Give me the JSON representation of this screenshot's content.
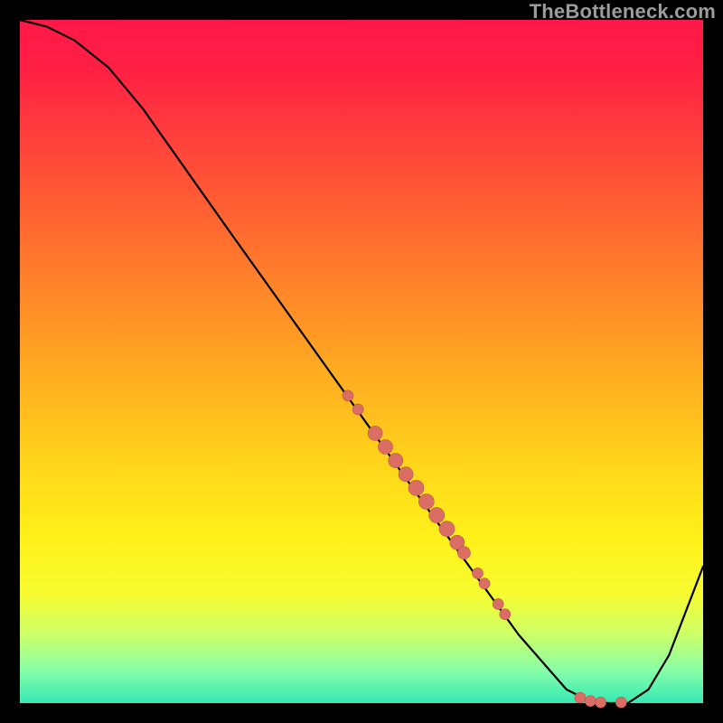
{
  "watermark": "TheBottleneck.com",
  "colors": {
    "marker_fill": "#db6e64",
    "marker_stroke": "#b95148",
    "curve_stroke": "#000000"
  },
  "chart_data": {
    "type": "line",
    "title": "",
    "xlabel": "",
    "ylabel": "",
    "xlim": [
      0,
      100
    ],
    "ylim": [
      0,
      100
    ],
    "grid": false,
    "curve": {
      "x": [
        0,
        4,
        8,
        13,
        18,
        30,
        45,
        60,
        73,
        80,
        83,
        86,
        89,
        92,
        95,
        100
      ],
      "values": [
        100,
        99,
        97,
        93,
        87,
        70,
        49,
        28,
        10,
        2,
        0.5,
        0,
        0,
        2,
        7,
        20
      ]
    },
    "markers_r": [
      {
        "x": 48,
        "y": 45,
        "r": 6
      },
      {
        "x": 49.5,
        "y": 43,
        "r": 6
      },
      {
        "x": 52,
        "y": 39.5,
        "r": 8
      },
      {
        "x": 53.5,
        "y": 37.5,
        "r": 8
      },
      {
        "x": 55,
        "y": 35.5,
        "r": 8
      },
      {
        "x": 56.5,
        "y": 33.5,
        "r": 8
      },
      {
        "x": 58,
        "y": 31.5,
        "r": 8.5
      },
      {
        "x": 59.5,
        "y": 29.5,
        "r": 8.5
      },
      {
        "x": 61,
        "y": 27.5,
        "r": 8.5
      },
      {
        "x": 62.5,
        "y": 25.5,
        "r": 8.5
      },
      {
        "x": 64,
        "y": 23.5,
        "r": 8
      },
      {
        "x": 65,
        "y": 22,
        "r": 7
      },
      {
        "x": 67,
        "y": 19,
        "r": 6
      },
      {
        "x": 68,
        "y": 17.5,
        "r": 6
      },
      {
        "x": 70,
        "y": 14.5,
        "r": 6
      },
      {
        "x": 71,
        "y": 13,
        "r": 6
      },
      {
        "x": 82,
        "y": 0.8,
        "r": 6
      },
      {
        "x": 83.5,
        "y": 0.3,
        "r": 6
      },
      {
        "x": 85,
        "y": 0.1,
        "r": 6
      },
      {
        "x": 88,
        "y": 0.1,
        "r": 6
      }
    ]
  }
}
